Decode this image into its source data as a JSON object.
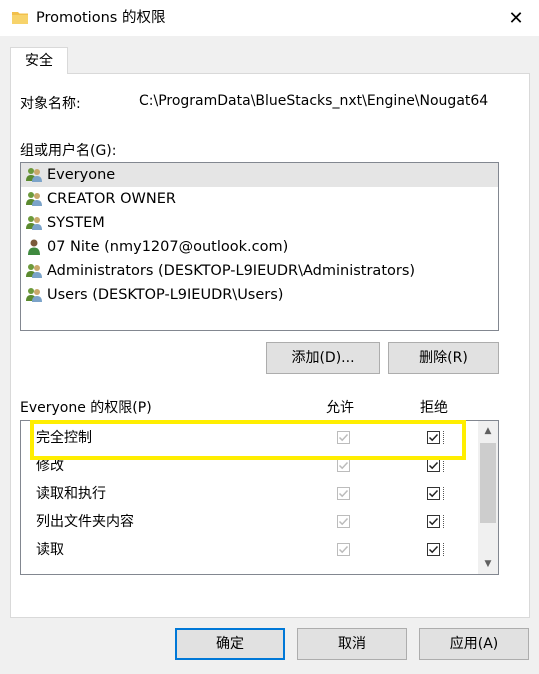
{
  "window": {
    "title": "Promotions 的权限",
    "close_glyph": "✕"
  },
  "tab": {
    "label": "安全"
  },
  "object": {
    "label": "对象名称:",
    "value": "C:\\ProgramData\\BlueStacks_nxt\\Engine\\Nougat64"
  },
  "groups": {
    "label": "组或用户名(G):",
    "items": [
      {
        "name": "Everyone",
        "icon": "group-icon"
      },
      {
        "name": "CREATOR OWNER",
        "icon": "group-icon"
      },
      {
        "name": "SYSTEM",
        "icon": "group-icon"
      },
      {
        "name": "07 Nite (nmy1207@outlook.com)",
        "icon": "user-icon"
      },
      {
        "name": "Administrators (DESKTOP-L9IEUDR\\Administrators)",
        "icon": "group-icon"
      },
      {
        "name": "Users (DESKTOP-L9IEUDR\\Users)",
        "icon": "group-icon"
      }
    ],
    "selected_index": 0
  },
  "buttons": {
    "add": "添加(D)...",
    "remove": "删除(R)",
    "ok": "确定",
    "cancel": "取消",
    "apply": "应用(A)"
  },
  "permissions": {
    "label": "Everyone 的权限(P)",
    "allow_header": "允许",
    "deny_header": "拒绝",
    "rows": [
      {
        "name": "完全控制",
        "allow": true,
        "deny": true
      },
      {
        "name": "修改",
        "allow": true,
        "deny": true
      },
      {
        "name": "读取和执行",
        "allow": true,
        "deny": true
      },
      {
        "name": "列出文件夹内容",
        "allow": true,
        "deny": true
      },
      {
        "name": "读取",
        "allow": true,
        "deny": true
      }
    ]
  },
  "colors": {
    "highlight": "#ffee00",
    "default_button_border": "#0078d7",
    "selected_row": "#e5e5e5"
  }
}
